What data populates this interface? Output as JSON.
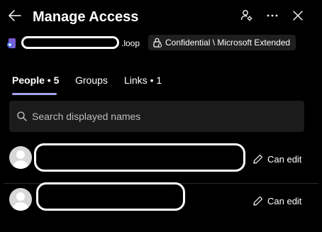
{
  "header": {
    "title": "Manage Access",
    "back_icon": "arrow-left-icon",
    "icons": [
      "people-settings-icon",
      "more-icon",
      "close-icon"
    ]
  },
  "file": {
    "icon": "loop-file-icon",
    "extension": ".loop",
    "sensitivity_label": "Confidential \\ Microsoft Extended"
  },
  "tabs": [
    {
      "label": "People • 5",
      "active": true
    },
    {
      "label": "Groups",
      "active": false
    },
    {
      "label": "Links • 1",
      "active": false
    }
  ],
  "search": {
    "placeholder": "Search displayed names",
    "value": ""
  },
  "people": [
    {
      "permission": "Can edit"
    },
    {
      "permission": "Can edit"
    }
  ],
  "colors": {
    "background": "#000000",
    "accent": "#a6a1ee",
    "search_bg": "#1b1b1b",
    "chip_bg": "#1f1f1f",
    "avatar": "#d8d8d8"
  }
}
